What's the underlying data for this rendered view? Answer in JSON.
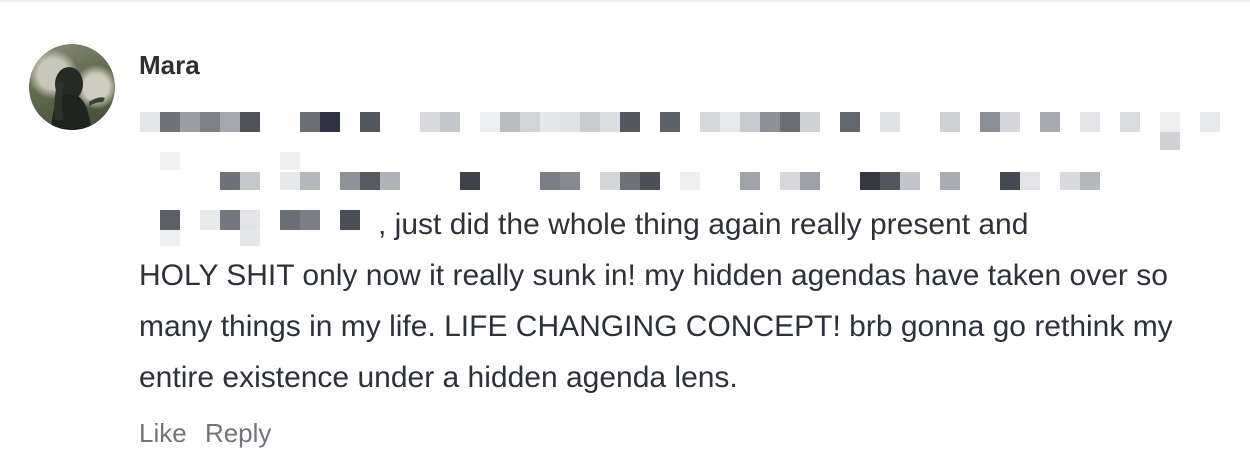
{
  "comment": {
    "author": "Mara",
    "avatar": "profile-photo",
    "first_line_visible": ", just did the whole thing again really present and",
    "body": "HOLY SHIT only now it really sunk in! my hidden agendas have taken over so many things in my life. LIFE CHANGING CONCEPT! brb gonna go rethink my entire existence under a hidden agenda lens.",
    "actions": {
      "like_label": "Like",
      "reply_label": "Reply"
    }
  },
  "colors": {
    "text": "#2c313a",
    "muted": "#70757d",
    "redaction_dark": "#4a505a",
    "redaction_light": "#e6e7ea"
  }
}
